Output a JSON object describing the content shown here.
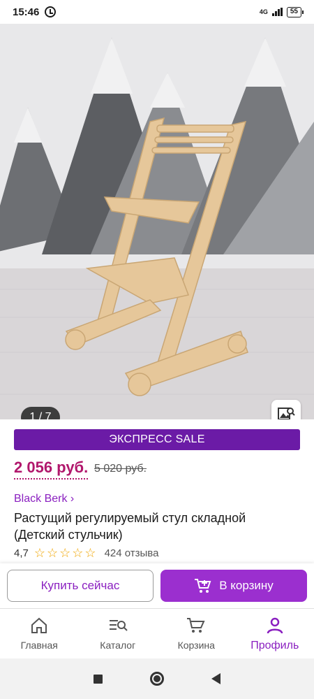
{
  "status_bar": {
    "time": "15:46",
    "network": "4G",
    "battery": "55"
  },
  "gallery": {
    "counter": "1 / 7",
    "search_icon": "image-search-icon"
  },
  "product": {
    "sale_banner": "ЭКСПРЕСС SALE",
    "price": "2 056 руб.",
    "old_price": "5 020 руб.",
    "brand": "Black Berk ›",
    "title": "Растущий регулируемый стул складной (Детский стульчик)",
    "rating": "4,7",
    "stars": 5,
    "reviews": "424 отзыва"
  },
  "actions": {
    "buy_now": "Купить сейчас",
    "to_cart": "В корзину"
  },
  "bottom_nav": {
    "items": [
      {
        "label": "Главная",
        "icon": "home-icon"
      },
      {
        "label": "Каталог",
        "icon": "catalog-search-icon"
      },
      {
        "label": "Корзина",
        "icon": "cart-icon"
      },
      {
        "label": "Профиль",
        "icon": "profile-icon",
        "active": true
      }
    ]
  },
  "colors": {
    "accent": "#8a1fc0",
    "banner": "#6b1ba6",
    "price": "#b1176c",
    "star": "#f0a500"
  }
}
